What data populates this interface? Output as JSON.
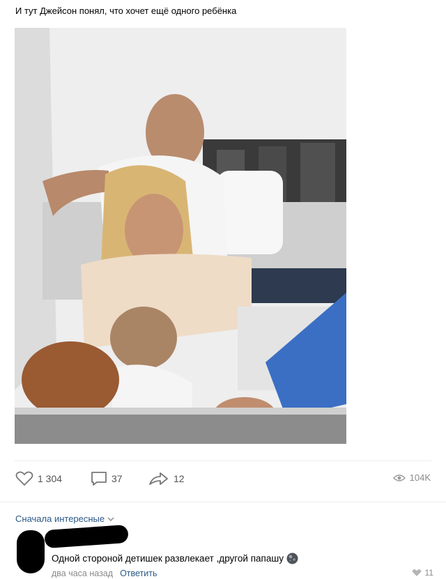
{
  "post": {
    "text": "И тут Джейсон понял, что хочет ещё одного ребёнка"
  },
  "actions": {
    "likes": "1 304",
    "comments": "37",
    "shares": "12",
    "views": "104K"
  },
  "comments": {
    "sort_label": "Сначала интересные"
  },
  "comment": {
    "text": "Одной стороной детишек развлекает ,другой папашу",
    "time": "два часа назад",
    "reply_label": "Ответить",
    "likes": "11"
  },
  "colors": {
    "link": "#2a5885",
    "muted": "#8a8a8a"
  }
}
